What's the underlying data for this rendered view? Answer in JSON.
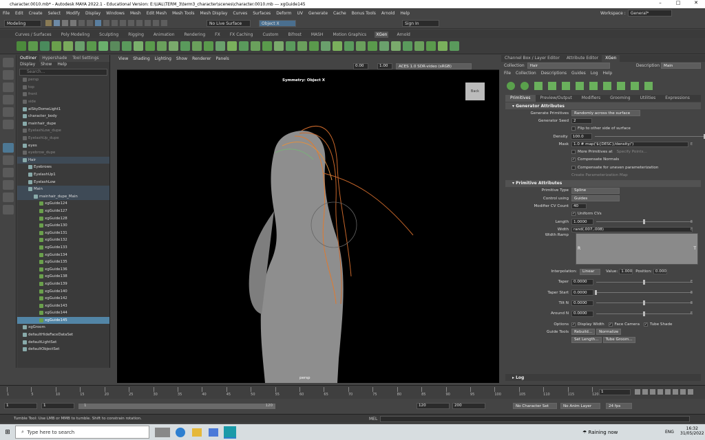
{
  "window": {
    "title": "character.0010.mb* - Autodesk MAYA 2022.1 - Educational Version: E:\\UAL\\TERM_3\\term3_character\\scenes\\character.0010.mb  ---  xgGuide145",
    "minimize": "–",
    "maximize": "□",
    "close": "✕"
  },
  "menus": [
    "File",
    "Edit",
    "Create",
    "Select",
    "Modify",
    "Display",
    "Windows",
    "Mesh",
    "Edit Mesh",
    "Mesh Tools",
    "Mesh Display",
    "Curves",
    "Surfaces",
    "Deform",
    "UV",
    "Generate",
    "Cache",
    "Bonus Tools",
    "Arnold",
    "Help"
  ],
  "workspace": {
    "label": "Workspace :",
    "value": "General*"
  },
  "status": {
    "mode": "Modeling",
    "live_surface": "No Live Surface",
    "symmetry": "Object X",
    "signin": "Sign In"
  },
  "shelf_tabs": [
    "Curves / Surfaces",
    "Poly Modeling",
    "Sculpting",
    "Rigging",
    "Animation",
    "Rendering",
    "FX",
    "FX Caching",
    "Custom",
    "Bifrost",
    "MASH",
    "Motion Graphics",
    "XGen",
    "Arnold"
  ],
  "shelf_active": "XGen",
  "outliner": {
    "tabs": [
      "Outliner",
      "Hypershade",
      "Tool Settings"
    ],
    "menu": [
      "Display",
      "Show",
      "Help"
    ],
    "search_placeholder": "Search...",
    "items": [
      {
        "label": "persp",
        "dim": true,
        "indent": 0
      },
      {
        "label": "top",
        "dim": true,
        "indent": 0
      },
      {
        "label": "front",
        "dim": true,
        "indent": 0
      },
      {
        "label": "side",
        "dim": true,
        "indent": 0
      },
      {
        "label": "aiSkyDomeLight1",
        "dim": false,
        "indent": 0
      },
      {
        "label": "character_body",
        "dim": false,
        "indent": 0
      },
      {
        "label": "mainhair_dupe",
        "dim": false,
        "indent": 0
      },
      {
        "label": "EyelashLow_dupe",
        "dim": true,
        "indent": 0
      },
      {
        "label": "EyelashUp_dupe",
        "dim": true,
        "indent": 0
      },
      {
        "label": "eyes",
        "dim": false,
        "indent": 0
      },
      {
        "label": "eyebrow_dupe",
        "dim": true,
        "indent": 0
      },
      {
        "label": "Hair",
        "dim": false,
        "indent": 0,
        "hl": true
      },
      {
        "label": "Eyebrows",
        "dim": false,
        "indent": 1
      },
      {
        "label": "EyelashUp1",
        "dim": false,
        "indent": 1
      },
      {
        "label": "EyelashLow",
        "dim": false,
        "indent": 1
      },
      {
        "label": "Main",
        "dim": false,
        "indent": 1,
        "hl": true
      },
      {
        "label": "mainhair_dupe_Main",
        "dim": false,
        "indent": 2,
        "hl": true
      },
      {
        "label": "xgGuide124",
        "dim": false,
        "indent": 3
      },
      {
        "label": "xgGuide127",
        "dim": false,
        "indent": 3
      },
      {
        "label": "xgGuide128",
        "dim": false,
        "indent": 3
      },
      {
        "label": "xgGuide130",
        "dim": false,
        "indent": 3
      },
      {
        "label": "xgGuide131",
        "dim": false,
        "indent": 3
      },
      {
        "label": "xgGuide132",
        "dim": false,
        "indent": 3
      },
      {
        "label": "xgGuide133",
        "dim": false,
        "indent": 3
      },
      {
        "label": "xgGuide134",
        "dim": false,
        "indent": 3
      },
      {
        "label": "xgGuide135",
        "dim": false,
        "indent": 3
      },
      {
        "label": "xgGuide136",
        "dim": false,
        "indent": 3
      },
      {
        "label": "xgGuide138",
        "dim": false,
        "indent": 3
      },
      {
        "label": "xgGuide139",
        "dim": false,
        "indent": 3
      },
      {
        "label": "xgGuide140",
        "dim": false,
        "indent": 3
      },
      {
        "label": "xgGuide142",
        "dim": false,
        "indent": 3
      },
      {
        "label": "xgGuide143",
        "dim": false,
        "indent": 3
      },
      {
        "label": "xgGuide144",
        "dim": false,
        "indent": 3
      },
      {
        "label": "xgGuide145",
        "dim": false,
        "indent": 3,
        "sel": true
      },
      {
        "label": "xgGroom",
        "dim": false,
        "indent": 0
      },
      {
        "label": "defaultHideFaceDataSet",
        "dim": false,
        "indent": 0
      },
      {
        "label": "defaultLightSet",
        "dim": false,
        "indent": 0
      },
      {
        "label": "defaultObjectSet",
        "dim": false,
        "indent": 0
      }
    ]
  },
  "viewport": {
    "menus": [
      "View",
      "Shading",
      "Lighting",
      "Show",
      "Renderer",
      "Panels"
    ],
    "symmetry_label": "Symmetry: Object X",
    "camera": "persp",
    "cube_label": "Back",
    "val1": "0.00",
    "val2": "1.00",
    "colorspace": "ACES 1.0 SDR-video (sRGB)"
  },
  "right_panel": {
    "tabs": [
      "Channel Box / Layer Editor",
      "Attribute Editor",
      "XGen"
    ],
    "active_tab": "XGen",
    "collection_label": "Collection",
    "collection_value": "Hair",
    "menus": [
      "File",
      "Collection",
      "Descriptions",
      "Guides",
      "Log",
      "Help"
    ],
    "description_label": "Description",
    "description_value": "Main",
    "sub_tabs": [
      "Primitives",
      "Preview/Output",
      "Modifiers",
      "Grooming",
      "Utilities",
      "Expressions"
    ],
    "gen_section": "Generator Attributes",
    "generate_primitives_label": "Generate Primitives",
    "generate_primitives_value": "Randomly across the surface",
    "seed_label": "Generator Seed",
    "seed_value": "2",
    "flip_label": "Flip to other side of surface",
    "density_label": "Density",
    "density_value": "100.0",
    "density_level": 1.0,
    "mask_label": "Mask",
    "mask_value": "1.0 # map('${DESC}/density/')",
    "more_prims_label": "More Primitives at",
    "specify_points": "Specify Points...",
    "comp_normals": "Compensate Normals",
    "comp_uneven": "Compensate for uneven parameterization",
    "create_param_map": "Create Parameterization Map",
    "prim_section": "Primitive Attributes",
    "ptype_label": "Primitive Type",
    "ptype_value": "Spline",
    "control_label": "Control using",
    "control_value": "Guides",
    "cv_label": "Modifier CV Count",
    "cv_value": "40",
    "uniform_cvs": "Uniform CVs",
    "length_label": "Length",
    "length_value": "1.0000",
    "length_level": 0.5,
    "width_label": "Width",
    "width_value": "rand(.007,.008)",
    "ramp_label": "Width Ramp",
    "ramp_r": "R",
    "ramp_t": "T",
    "interp_label": "Interpolation:",
    "interp_value": "Linear",
    "value_label": "Value:",
    "value_value": "1.000",
    "position_label": "Position:",
    "position_value": "0.000",
    "taper_label": "Taper",
    "taper_value": "0.0000",
    "taper_level": 0.5,
    "taper_start_label": "Taper Start",
    "taper_start_value": "0.0000",
    "taper_start_level": 0.0,
    "tilt_label": "Tilt N",
    "tilt_value": "0.0000",
    "tilt_level": 0.5,
    "around_label": "Around N",
    "around_value": "0.0000",
    "around_level": 0.5,
    "options_label": "Options",
    "display_width": "Display Width",
    "face_camera": "Face Camera",
    "tube_shade": "Tube Shade",
    "guide_tools_label": "Guide Tools",
    "rebuild": "Rebuild...",
    "normalize": "Normalize",
    "set_length": "Set Length...",
    "tube_groom": "Tube Groom...",
    "log": "Log",
    "expr_icon": "E",
    "arrow_down": "▾"
  },
  "timeline": {
    "ticks": [
      "1",
      "5",
      "10",
      "15",
      "20",
      "25",
      "30",
      "35",
      "40",
      "45",
      "50",
      "55",
      "60",
      "65",
      "70",
      "75",
      "80",
      "85",
      "90",
      "95",
      "100",
      "105",
      "110",
      "115",
      "120"
    ],
    "current": "1"
  },
  "range": {
    "start": "1",
    "start2": "1",
    "slider_val": "1",
    "end_inner": "120",
    "end": "120",
    "end2": "200",
    "character_set": "No Character Set",
    "anim_layer": "No Anim Layer",
    "fps": "24 fps"
  },
  "cmdline": {
    "help": "Tumble Tool: Use LMB or MMB to tumble. Shift to constrain rotation.",
    "mel": "MEL"
  },
  "taskbar": {
    "search": "Type here to search",
    "weather": "Raining now",
    "lang": "ENG",
    "time": "16:32",
    "date": "31/05/2022"
  }
}
